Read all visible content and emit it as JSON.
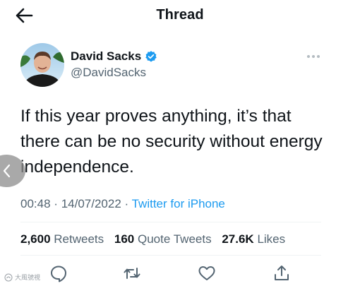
{
  "header": {
    "title": "Thread",
    "back_icon": "arrow-left-icon"
  },
  "author": {
    "display_name": "David Sacks",
    "handle": "@DavidSacks",
    "verified": true,
    "verified_color": "#1d9bf0"
  },
  "tweet": {
    "text": "If this year proves anything, it’s that there can be no security without energy independence.",
    "time": "00:48",
    "date": "14/07/2022",
    "source": "Twitter for iPhone",
    "separator": "·"
  },
  "stats": {
    "retweets": {
      "count": "2,600",
      "label": "Retweets"
    },
    "quote_tweets": {
      "count": "160",
      "label": "Quote Tweets"
    },
    "likes": {
      "count": "27.6K",
      "label": "Likes"
    }
  },
  "actions": [
    "reply-icon",
    "retweet-icon",
    "like-icon",
    "share-icon"
  ],
  "watermark": {
    "text": "大風號視"
  },
  "colors": {
    "accent": "#1d9bf0",
    "secondary_text": "#536471",
    "primary_text": "#0f1419"
  }
}
